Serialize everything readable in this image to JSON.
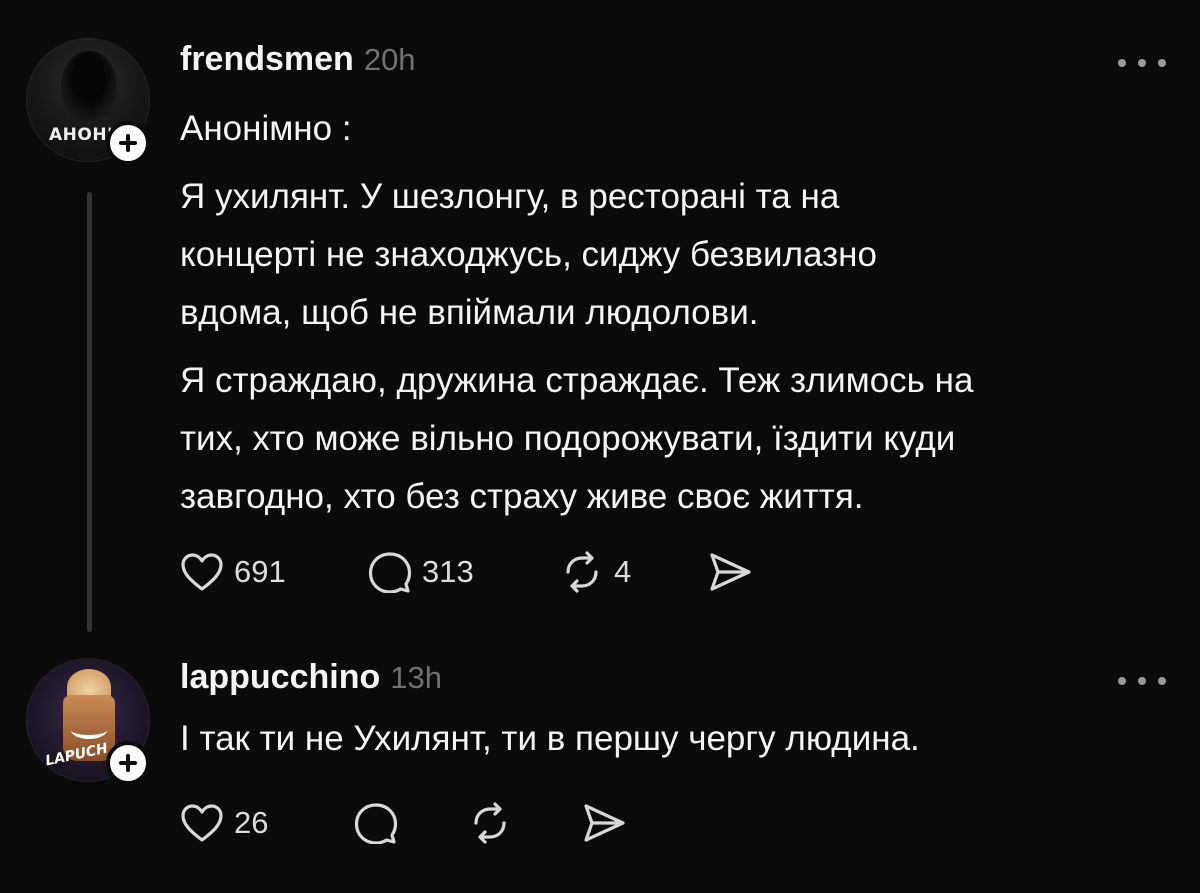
{
  "posts": [
    {
      "username": "frendsmen",
      "time": "20h",
      "avatar_text": "АНОН'",
      "paragraphs": [
        "Анонімно :",
        "Я ухилянт. У шезлонгу, в ресторані та на\nконцерті не знаходжусь, сиджу безвилазно\nвдома, щоб не впіймали людолови.",
        "Я страждаю, дружина страждає. Теж злимось на\nтих, хто може вільно подорожувати, їздити куди\nзавгодно, хто без страху живе своє життя."
      ],
      "likes": "691",
      "replies": "313",
      "reposts": "4",
      "icons": [
        "heart-icon",
        "comment-icon",
        "repost-icon",
        "share-icon",
        "more-icon",
        "plus-icon"
      ]
    },
    {
      "username": "lappucchino",
      "time": "13h",
      "avatar_text": "LAPUCH",
      "paragraphs": [
        "І так ти не Ухилянт, ти в першу чергу людина."
      ],
      "likes": "26",
      "icons": [
        "heart-icon",
        "comment-icon",
        "repost-icon",
        "share-icon",
        "more-icon",
        "plus-icon"
      ]
    }
  ],
  "colors": {
    "background": "#0a0a0a",
    "text": "#f3f5f7",
    "muted": "#707070",
    "thread_line": "#333333"
  }
}
